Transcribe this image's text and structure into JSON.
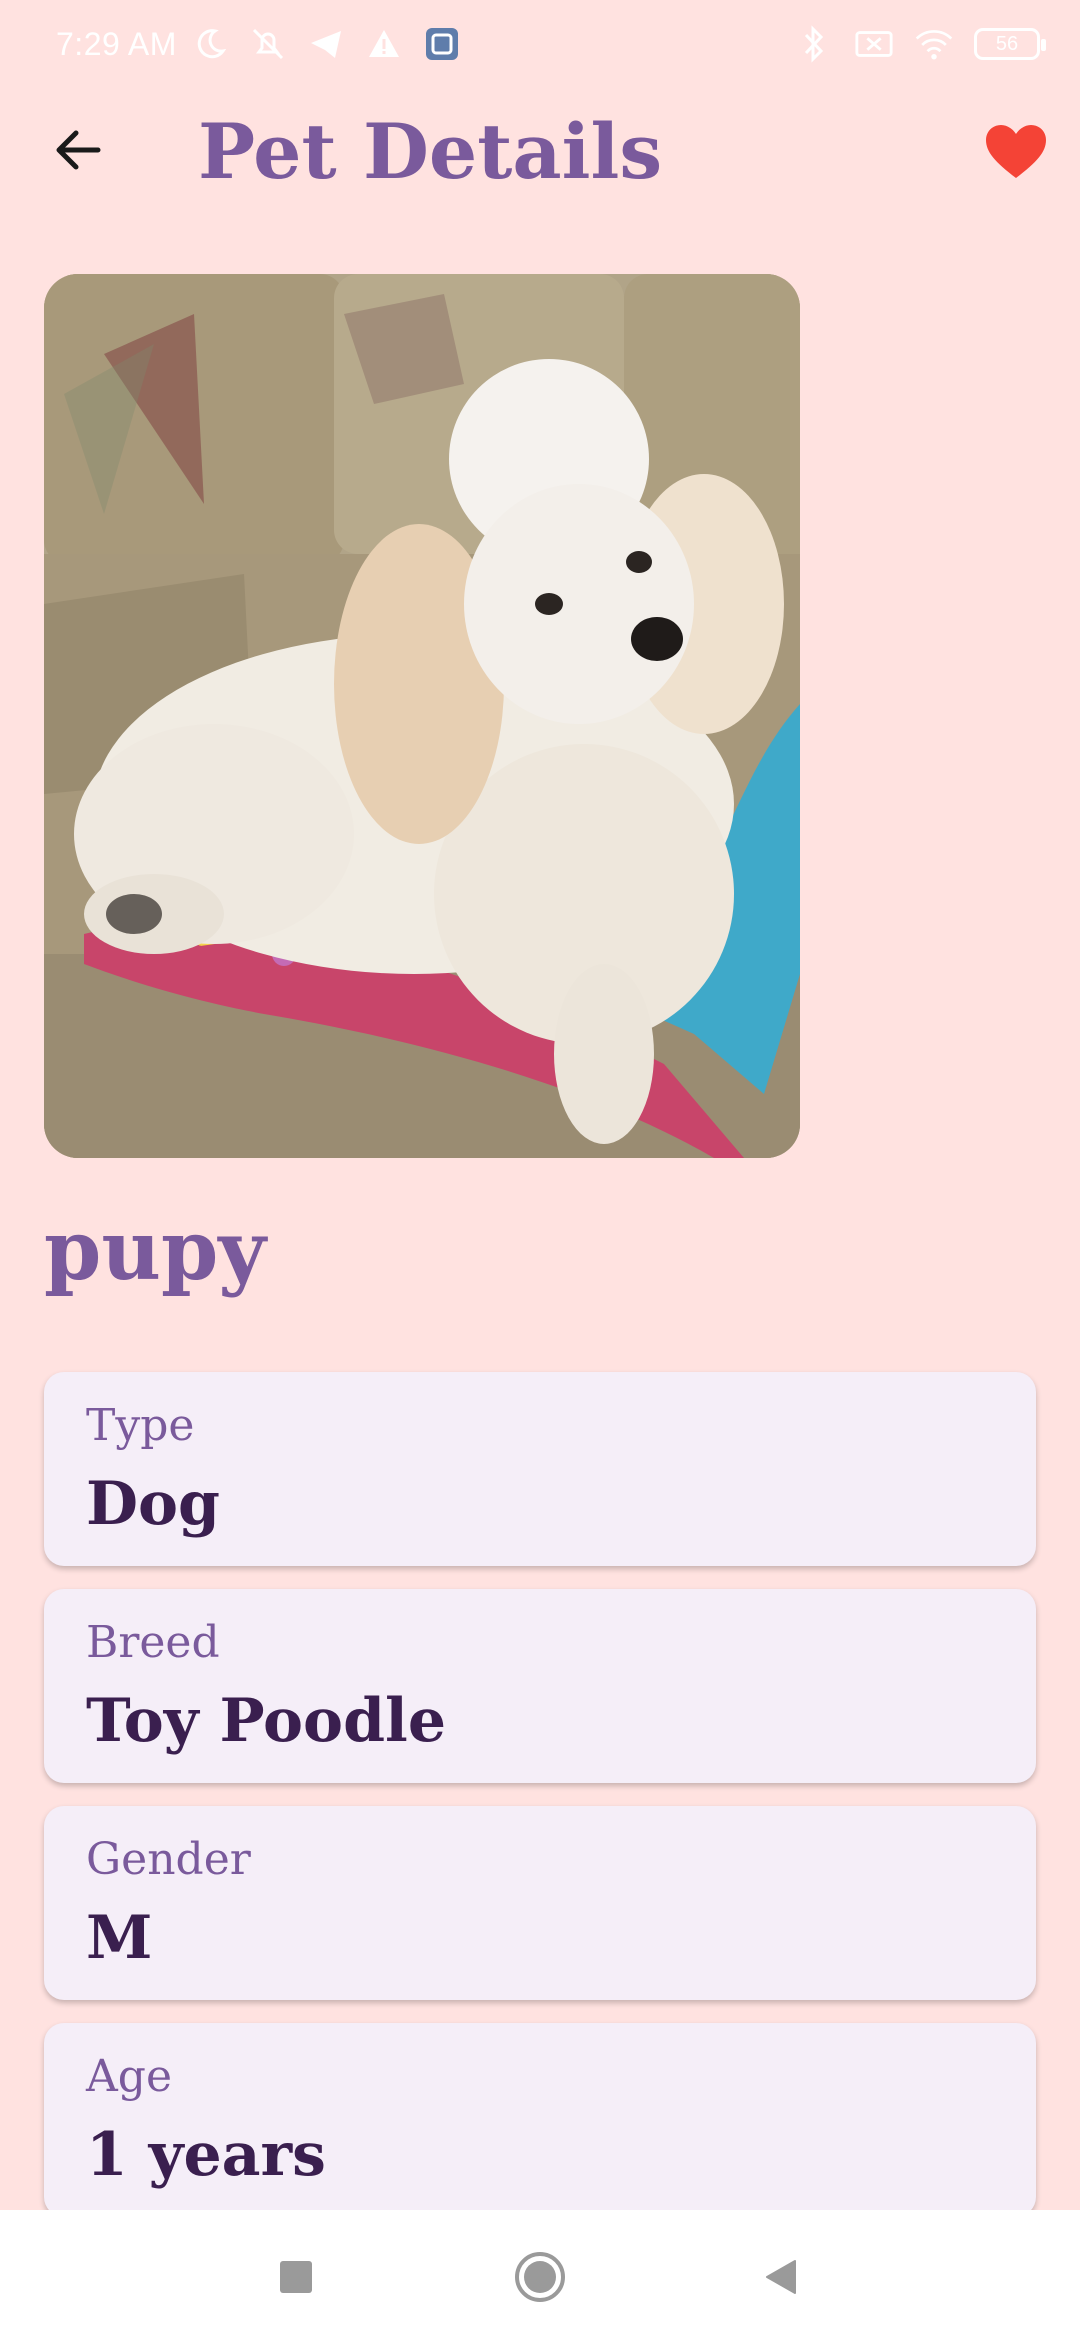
{
  "status_bar": {
    "time": "7:29 AM",
    "battery": "56",
    "icons": [
      "moon-icon",
      "muted-bell-icon",
      "telegram-icon",
      "warning-icon",
      "gallery-icon",
      "bluetooth-icon",
      "no-sim-icon",
      "wifi-icon",
      "battery-icon"
    ]
  },
  "app_bar": {
    "title": "Pet Details",
    "back_icon": "arrow-left-icon",
    "favorite_icon": "heart-icon",
    "favorite_color": "#f44336"
  },
  "pet": {
    "name": "pupy",
    "photo": "toy-poodle-photo"
  },
  "details": [
    {
      "label": "Type",
      "value": "Dog"
    },
    {
      "label": "Breed",
      "value": "Toy Poodle"
    },
    {
      "label": "Gender",
      "value": "M"
    },
    {
      "label": "Age",
      "value": "1 years"
    }
  ],
  "nav_bar": {
    "icons": [
      "recents-square-icon",
      "home-circle-icon",
      "back-triangle-icon"
    ]
  },
  "colors": {
    "background": "#ffe2e0",
    "accent": "#7a5a9c",
    "value_text": "#3a1f4f",
    "card": "#f5eef8"
  }
}
